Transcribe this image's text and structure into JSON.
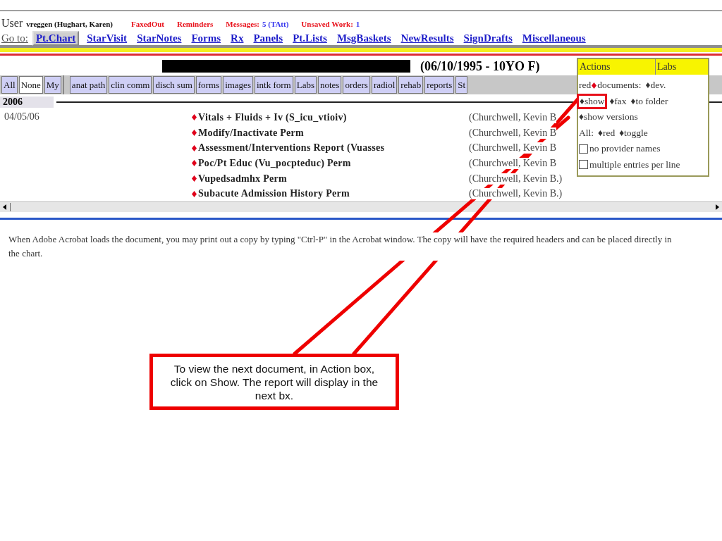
{
  "header": {
    "user_label": "User",
    "user_name": "vreggen (Hughart, Karen)",
    "alerts": [
      {
        "label": "FaxedOut"
      },
      {
        "label": "Reminders"
      },
      {
        "label": "Messages:",
        "count": "5 (TAtt)"
      },
      {
        "label": "Unsaved Work:",
        "count": "1"
      }
    ]
  },
  "goto": {
    "label": "Go to:",
    "links": [
      {
        "label": "Pt.Chart",
        "selected": true
      },
      {
        "label": "StarVisit",
        "selected": false
      },
      {
        "label": "StarNotes",
        "selected": false
      },
      {
        "label": "Forms",
        "selected": false
      },
      {
        "label": "Rx",
        "selected": false
      },
      {
        "label": "Panels",
        "selected": false
      },
      {
        "label": "Pt.Lists",
        "selected": false
      },
      {
        "label": "MsgBaskets",
        "selected": false
      },
      {
        "label": "NewResults",
        "selected": false
      },
      {
        "label": "SignDrafts",
        "selected": false
      },
      {
        "label": "Miscellaneous",
        "selected": false
      }
    ]
  },
  "patient": {
    "dob": "(06/10/1995 - 10YO F)"
  },
  "quick_tabs": [
    {
      "label": "All",
      "selected": false
    },
    {
      "label": "None",
      "selected": true
    },
    {
      "label": "My",
      "selected": false
    }
  ],
  "category_tabs": [
    {
      "label": "anat path",
      "selected": false
    },
    {
      "label": "clin comm",
      "selected": false
    },
    {
      "label": "disch sum",
      "selected": false
    },
    {
      "label": "forms",
      "selected": false
    },
    {
      "label": "images",
      "selected": false
    },
    {
      "label": "intk form",
      "selected": false
    },
    {
      "label": "Labs",
      "selected": false
    },
    {
      "label": "notes",
      "selected": false
    },
    {
      "label": "orders",
      "selected": false
    },
    {
      "label": "radiol",
      "selected": false
    },
    {
      "label": "rehab",
      "selected": false
    },
    {
      "label": "reports",
      "selected": false
    },
    {
      "label": "St",
      "selected": false
    }
  ],
  "documents": {
    "year": "2006",
    "date": "04/05/06",
    "entries": [
      {
        "title": "Vitals + Fluids + Iv (S_icu_vtioiv)",
        "author": "(Churchwell, Kevin B"
      },
      {
        "title": "Modify/Inactivate Perm",
        "author": "(Churchwell, Kevin B"
      },
      {
        "title": "Assessment/Interventions Report (Vuasses",
        "author": "(Churchwell, Kevin B"
      },
      {
        "title": "Poc/Pt Educ (Vu_pocpteduc) Perm",
        "author": "(Churchwell, Kevin B"
      },
      {
        "title": "Vupedsadmhx Perm",
        "author": "(Churchwell, Kevin B.)"
      },
      {
        "title": "Subacute Admission History Perm",
        "author": "(Churchwell, Kevin B.)"
      }
    ]
  },
  "note": "When Adobe Acrobat loads the document, you may print out a copy by typing \"Ctrl-P\" in the Acrobat window. The copy will have the required headers and can be placed directly in the chart.",
  "actions_panel": {
    "tabs": [
      "Actions",
      "Labs"
    ],
    "rows": [
      {
        "items": [
          {
            "kind": "text",
            "label": "red"
          },
          {
            "kind": "mark"
          },
          {
            "kind": "text",
            "label": "documents:"
          },
          {
            "kind": "link",
            "label": "♦dev.",
            "highlighted": false
          }
        ]
      },
      {
        "items": [
          {
            "kind": "link",
            "label": "♦show",
            "highlighted": true
          },
          {
            "kind": "link",
            "label": "♦fax",
            "highlighted": false
          },
          {
            "kind": "link",
            "label": "♦to folder",
            "highlighted": false
          }
        ]
      },
      {
        "items": [
          {
            "kind": "link",
            "label": "♦show versions",
            "highlighted": false
          }
        ]
      },
      {
        "items": [
          {
            "kind": "text",
            "label": "All:"
          },
          {
            "kind": "link",
            "label": "♦red",
            "highlighted": false
          },
          {
            "kind": "link",
            "label": "♦toggle",
            "highlighted": false
          }
        ]
      },
      {
        "items": [
          {
            "kind": "checkbox",
            "label": "no provider names",
            "checked": false
          }
        ]
      },
      {
        "items": [
          {
            "kind": "checkbox",
            "label": "multiple entries per line",
            "checked": false
          }
        ]
      }
    ]
  },
  "callout": {
    "text": "To view the next document, in Action box, click on Show. The report will display in the next bx."
  }
}
